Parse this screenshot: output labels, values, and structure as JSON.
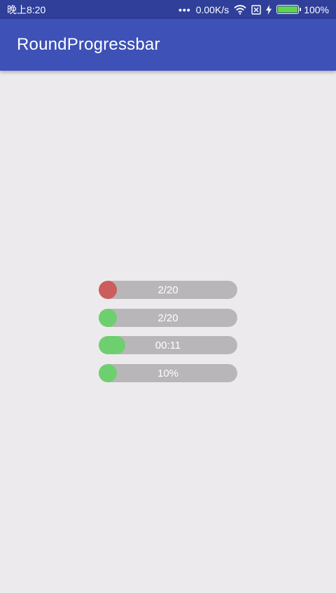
{
  "status_bar": {
    "time": "晚上8:20",
    "dots": "•••",
    "network_speed": "0.00K/s",
    "battery_percent": "100%",
    "icons": [
      "wifi-icon",
      "sim-x-icon",
      "charging-icon",
      "battery-icon"
    ],
    "battery_level": 1.0
  },
  "app_bar": {
    "title": "RoundProgressbar"
  },
  "colors": {
    "status_bar": "#2f3f9a",
    "app_bar": "#3d51b6",
    "background": "#edeaed",
    "track": "#b9b6b9",
    "red_fill": "#cd5c5c",
    "green_fill": "#6ecf6e",
    "battery_green": "#62d24f"
  },
  "progress_bars": [
    {
      "label": "2/20",
      "progress": 0.1,
      "color": "#cd5c5c"
    },
    {
      "label": "2/20",
      "progress": 0.1,
      "color": "#6ecf6e"
    },
    {
      "label": "00:11",
      "progress": 0.19,
      "color": "#6ecf6e"
    },
    {
      "label": "10%",
      "progress": 0.1,
      "color": "#6ecf6e"
    }
  ]
}
